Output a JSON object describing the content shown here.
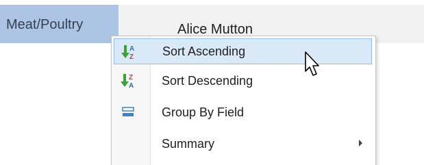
{
  "grid_row": {
    "category": "Meat/Poultry",
    "product": "Alice Mutton"
  },
  "context_menu": {
    "items": [
      {
        "label": "Sort Ascending",
        "icon": "sort-ascending-icon"
      },
      {
        "label": "Sort Descending",
        "icon": "sort-descending-icon"
      },
      {
        "label": "Group By Field",
        "icon": "group-by-field-icon"
      },
      {
        "label": "Summary",
        "icon": "submenu-arrow-icon"
      }
    ]
  },
  "colors": {
    "selected_cell": "#adc4e4",
    "hover_item": "#dae9f8",
    "hover_border": "#94bde7",
    "sort_arrow_green": "#3aa335",
    "sort_letter_red": "#d23a2a",
    "group_icon_blue": "#3f83c7"
  }
}
